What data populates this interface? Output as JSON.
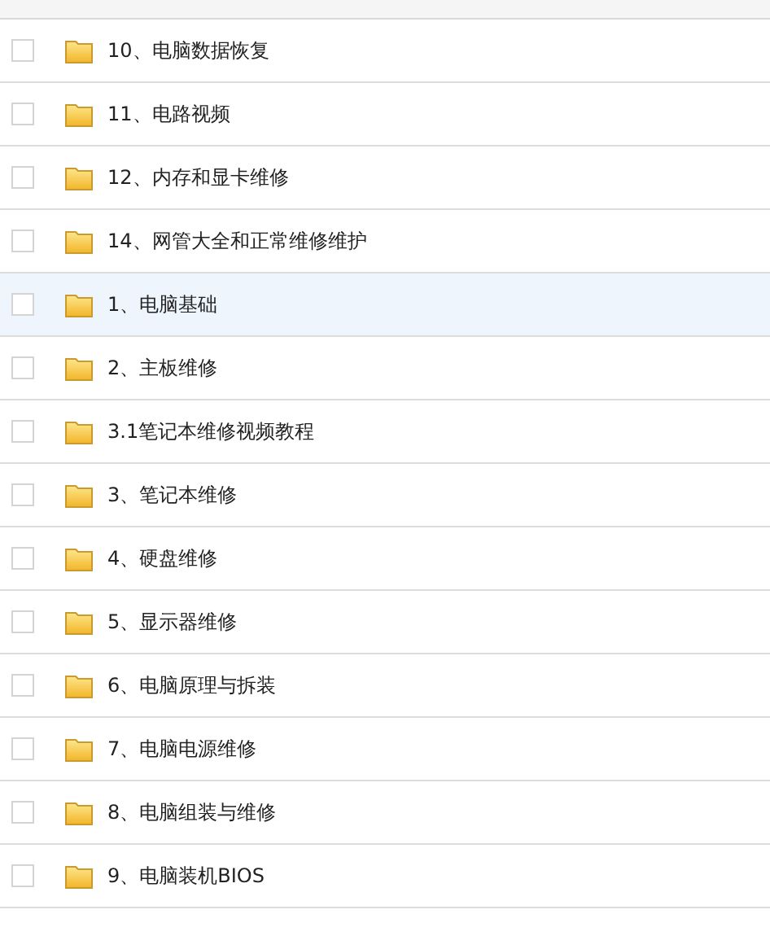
{
  "rows": [
    {
      "name": "10、电脑数据恢复",
      "checked": false,
      "selected": false
    },
    {
      "name": "11、电路视频",
      "checked": false,
      "selected": false
    },
    {
      "name": "12、内存和显卡维修",
      "checked": false,
      "selected": false
    },
    {
      "name": "14、网管大全和正常维修维护",
      "checked": false,
      "selected": false
    },
    {
      "name": "1、电脑基础",
      "checked": false,
      "selected": true
    },
    {
      "name": "2、主板维修",
      "checked": false,
      "selected": false
    },
    {
      "name": "3.1笔记本维修视频教程",
      "checked": false,
      "selected": false
    },
    {
      "name": "3、笔记本维修",
      "checked": false,
      "selected": false
    },
    {
      "name": "4、硬盘维修",
      "checked": false,
      "selected": false
    },
    {
      "name": "5、显示器维修",
      "checked": false,
      "selected": false
    },
    {
      "name": "6、电脑原理与拆装",
      "checked": false,
      "selected": false
    },
    {
      "name": "7、电脑电源维修",
      "checked": false,
      "selected": false
    },
    {
      "name": "8、电脑组装与维修",
      "checked": false,
      "selected": false
    },
    {
      "name": "9、电脑装机BIOS",
      "checked": false,
      "selected": false
    }
  ]
}
